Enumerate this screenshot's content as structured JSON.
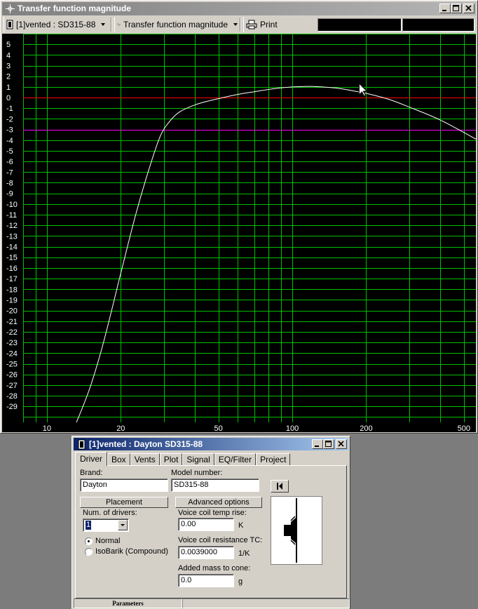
{
  "main_window": {
    "title": "Transfer function magnitude",
    "toolbar": {
      "project_selector": "[1]vented : SD315-88",
      "view_selector": "Transfer function magnitude",
      "print_label": "Print"
    }
  },
  "chart_data": {
    "type": "line",
    "title": "",
    "xlabel": "",
    "ylabel": "",
    "xscale": "log",
    "xlim": [
      8,
      560
    ],
    "ylim": [
      -30.5,
      6
    ],
    "x_tick_labels": [
      "10",
      "20",
      "50",
      "100",
      "200",
      "500"
    ],
    "x_tick_values": [
      10,
      20,
      50,
      100,
      200,
      500
    ],
    "y_tick_labels": [
      "5",
      "4",
      "3",
      "2",
      "1",
      "0",
      "-1",
      "-2",
      "-3",
      "-4",
      "-5",
      "-6",
      "-7",
      "-8",
      "-9",
      "-10",
      "-11",
      "-12",
      "-13",
      "-14",
      "-15",
      "-16",
      "-17",
      "-18",
      "-19",
      "-20",
      "-21",
      "-22",
      "-23",
      "-24",
      "-25",
      "-26",
      "-27",
      "-28",
      "-29"
    ],
    "grid": true,
    "reference_lines": [
      {
        "y": 0,
        "color": "#ff0000"
      },
      {
        "y": -3,
        "color": "#ff00ff"
      }
    ],
    "series": [
      {
        "color": "#ffffff",
        "x": [
          13.2,
          15,
          17,
          20,
          23,
          26,
          29,
          32,
          35,
          40,
          45,
          50,
          60,
          70,
          85,
          100,
          120,
          150,
          180,
          200,
          250,
          300,
          400,
          560
        ],
        "y": [
          -30.5,
          -27.2,
          -23,
          -16.5,
          -11,
          -6.8,
          -3.6,
          -2.1,
          -1.3,
          -0.7,
          -0.35,
          -0.1,
          0.3,
          0.55,
          0.85,
          1.0,
          1.05,
          0.9,
          0.6,
          0.4,
          -0.2,
          -0.9,
          -2.1,
          -3.9
        ]
      }
    ],
    "background": "#000000",
    "grid_color": "#00c000",
    "cursor_at": {
      "x": 200,
      "y": 0.4
    }
  },
  "driver_window": {
    "title": "[1]vented : Dayton SD315-88",
    "tabs": [
      "Driver",
      "Box",
      "Vents",
      "Plot",
      "Signal",
      "EQ/Filter",
      "Project"
    ],
    "active_tab": "Driver",
    "brand_label": "Brand:",
    "brand_value": "Dayton",
    "model_label": "Model number:",
    "model_value": "SD315-88",
    "placement_button": "Placement",
    "advanced_button": "Advanced options",
    "num_drivers_label": "Num. of drivers:",
    "num_drivers_value": "1",
    "radio_normal": "Normal",
    "radio_isobarik": "IsoBarik (Compound)",
    "vc_temp_label": "Voice coil temp rise:",
    "vc_temp_value": "0.00",
    "vc_temp_unit": "K",
    "vc_tc_label": "Voice coil resistance TC:",
    "vc_tc_value": "0.0039000",
    "vc_tc_unit": "1/K",
    "added_mass_label": "Added mass to cone:",
    "added_mass_value": "0.0",
    "added_mass_unit": "g",
    "status_parameters": "Parameters"
  }
}
